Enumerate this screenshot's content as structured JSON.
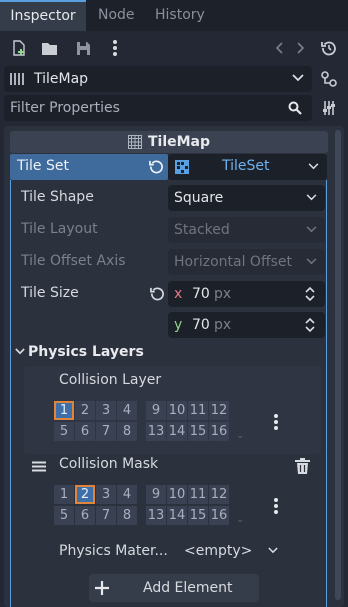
{
  "tabs": [
    {
      "label": "Inspector",
      "active": true
    },
    {
      "label": "Node",
      "active": false
    },
    {
      "label": "History",
      "active": false
    }
  ],
  "toolbar": {
    "icons": [
      "new-resource-icon",
      "open-folder-icon",
      "save-icon",
      "more-vert-icon",
      "back-icon",
      "forward-icon",
      "history-icon"
    ]
  },
  "object_selector": {
    "value": "TileMap"
  },
  "filter": {
    "placeholder": "Filter Properties"
  },
  "section": {
    "title": "TileMap"
  },
  "tile_set": {
    "label": "Tile Set",
    "resource": "TileSet"
  },
  "properties": {
    "tile_shape": {
      "label": "Tile Shape",
      "value": "Square"
    },
    "tile_layout": {
      "label": "Tile Layout",
      "value": "Stacked"
    },
    "tile_offset_axis": {
      "label": "Tile Offset Axis",
      "value": "Horizontal Offset"
    },
    "tile_size": {
      "label": "Tile Size",
      "x_label": "x",
      "x_value": "70",
      "y_label": "y",
      "y_value": "70",
      "unit": "px"
    }
  },
  "physics_layers": {
    "title": "Physics Layers",
    "collision_layer": {
      "label": "Collision Layer",
      "numbers": [
        "1",
        "2",
        "3",
        "4",
        "9",
        "10",
        "11",
        "12",
        "5",
        "6",
        "7",
        "8",
        "13",
        "14",
        "15",
        "16"
      ],
      "selected": [
        "1"
      ]
    },
    "collision_mask": {
      "label": "Collision Mask",
      "numbers": [
        "1",
        "2",
        "3",
        "4",
        "9",
        "10",
        "11",
        "12",
        "5",
        "6",
        "7",
        "8",
        "13",
        "14",
        "15",
        "16"
      ],
      "selected": [
        "2"
      ]
    },
    "physics_material": {
      "label": "Physics Mater...",
      "value": "<empty>"
    },
    "add_element": "Add Element"
  },
  "colors": {
    "accent": "#5aa0e0",
    "selected_bit": "#3e6fa8",
    "selected_outline": "#e2853c"
  }
}
